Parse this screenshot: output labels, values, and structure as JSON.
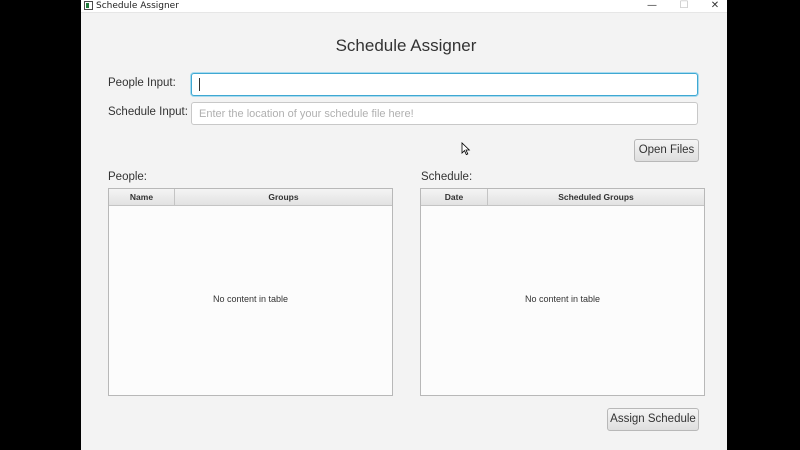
{
  "window": {
    "title": "Schedule Assigner",
    "controls": {
      "minimize": "—",
      "maximize": "☐",
      "close": "✕"
    }
  },
  "main": {
    "heading": "Schedule Assigner",
    "people_input": {
      "label": "People Input:",
      "value": "",
      "placeholder": ""
    },
    "schedule_input": {
      "label": "Schedule Input:",
      "value": "",
      "placeholder": "Enter the location of your schedule file here!"
    },
    "open_files_label": "Open Files",
    "people_table": {
      "label": "People:",
      "columns": [
        "Name",
        "Groups"
      ],
      "empty_text": "No content in table"
    },
    "schedule_table": {
      "label": "Schedule:",
      "columns": [
        "Date",
        "Scheduled Groups"
      ],
      "empty_text": "No content in table"
    },
    "assign_label": "Assign Schedule"
  },
  "colors": {
    "focus_ring": "#3fa8d2",
    "window_bg": "#f3f3f3"
  },
  "icons": [
    "app-icon",
    "mouse-cursor-icon"
  ]
}
